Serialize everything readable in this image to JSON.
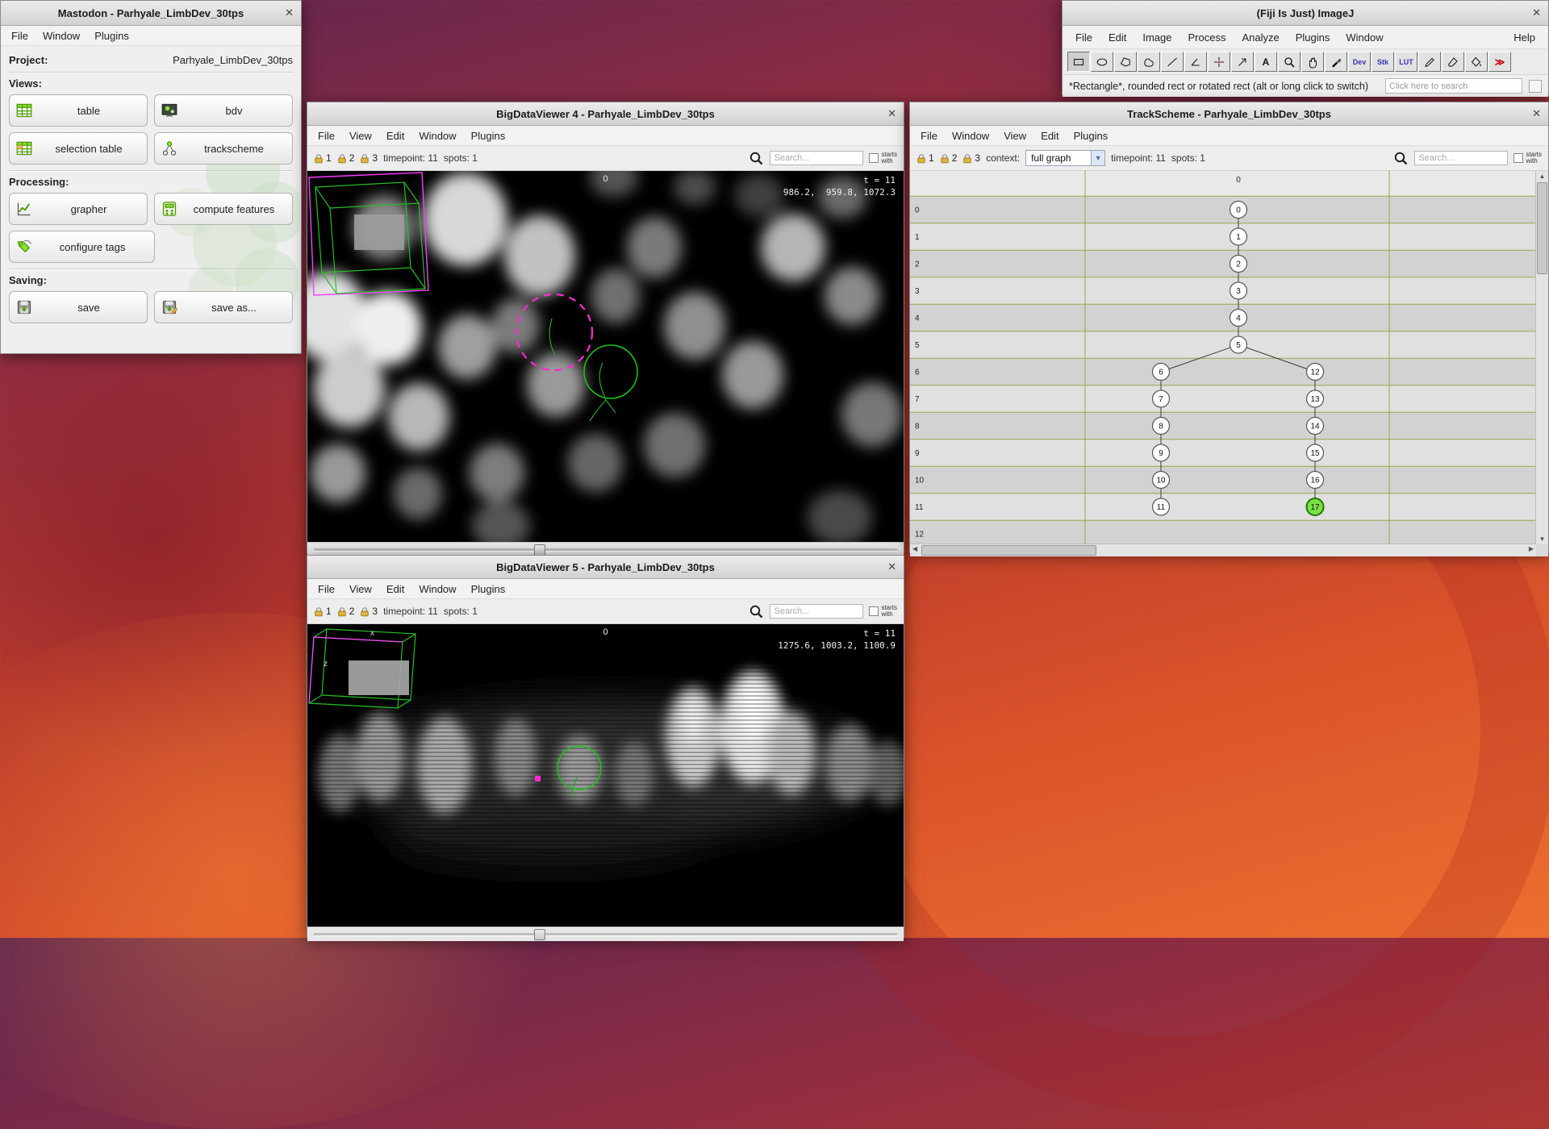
{
  "ui": {
    "close_glyph": "✕",
    "combo_arrow": "▾",
    "arrow_up": "▲",
    "arrow_down": "▼",
    "arrow_left": "◀",
    "arrow_right": "▶"
  },
  "mastodon": {
    "title": "Mastodon - Parhyale_LimbDev_30tps",
    "menus": [
      "File",
      "Window",
      "Plugins"
    ],
    "project_label": "Project:",
    "project_value": "Parhyale_LimbDev_30tps",
    "views_label": "Views:",
    "views": [
      {
        "label": "table",
        "icon": "table-icon"
      },
      {
        "label": "bdv",
        "icon": "bdv-icon"
      },
      {
        "label": "selection table",
        "icon": "selection-table-icon"
      },
      {
        "label": "trackscheme",
        "icon": "trackscheme-icon"
      }
    ],
    "processing_label": "Processing:",
    "processing": [
      {
        "label": "grapher",
        "icon": "grapher-icon"
      },
      {
        "label": "compute features",
        "icon": "compute-features-icon"
      },
      {
        "label": "configure tags",
        "icon": "configure-tags-icon"
      }
    ],
    "saving_label": "Saving:",
    "saving": [
      {
        "label": "save",
        "icon": "save-icon"
      },
      {
        "label": "save as...",
        "icon": "save-as-icon"
      }
    ]
  },
  "imagej": {
    "title": "(Fiji Is Just) ImageJ",
    "menus": [
      "File",
      "Edit",
      "Image",
      "Process",
      "Analyze",
      "Plugins",
      "Window",
      "Help"
    ],
    "tools": [
      {
        "name": "rectangle-tool"
      },
      {
        "name": "oval-tool"
      },
      {
        "name": "polygon-tool"
      },
      {
        "name": "freehand-tool"
      },
      {
        "name": "line-tool"
      },
      {
        "name": "angle-tool"
      },
      {
        "name": "point-tool"
      },
      {
        "name": "arrow-tool"
      },
      {
        "name": "text-tool",
        "label": "A"
      },
      {
        "name": "zoom-tool"
      },
      {
        "name": "hand-tool"
      },
      {
        "name": "color-picker-tool"
      },
      {
        "name": "dev-tool",
        "label": "Dev"
      },
      {
        "name": "stk-tool",
        "label": "Stk"
      },
      {
        "name": "lut-tool",
        "label": "LUT"
      },
      {
        "name": "pencil-tool"
      },
      {
        "name": "brush-tool"
      },
      {
        "name": "flood-fill-tool"
      },
      {
        "name": "more-tools",
        "label": "≫"
      }
    ],
    "status": "*Rectangle*, rounded rect or rotated rect (alt or long click to switch)",
    "search_placeholder": "Click here to search"
  },
  "bdv4": {
    "title": "BigDataViewer 4 - Parhyale_LimbDev_30tps",
    "menus": [
      "File",
      "View",
      "Edit",
      "Window",
      "Plugins"
    ],
    "locks": [
      "1",
      "2",
      "3"
    ],
    "timepoint": "timepoint: 11",
    "spots": "spots: 1",
    "search_placeholder": "Search...",
    "starts_with_1": "starts",
    "starts_with_2": "with",
    "overlay_source": "0",
    "overlay_time": "t = 11",
    "overlay_coords": "986.2,  959.8, 1072.3"
  },
  "bdv5": {
    "title": "BigDataViewer 5 - Parhyale_LimbDev_30tps",
    "menus": [
      "File",
      "View",
      "Edit",
      "Window",
      "Plugins"
    ],
    "locks": [
      "1",
      "2",
      "3"
    ],
    "timepoint": "timepoint: 11",
    "spots": "spots: 1",
    "search_placeholder": "Search...",
    "starts_with_1": "starts",
    "starts_with_2": "with",
    "overlay_source": "0",
    "overlay_time": "t = 11",
    "overlay_coords": "1275.6, 1003.2, 1100.9",
    "axis_x": "x",
    "axis_z": "z"
  },
  "trackscheme": {
    "title": "TrackScheme - Parhyale_LimbDev_30tps",
    "menus": [
      "File",
      "Window",
      "View",
      "Edit",
      "Plugins"
    ],
    "locks": [
      "1",
      "2",
      "3"
    ],
    "context_label": "context:",
    "context_value": "full graph",
    "timepoint": "timepoint: 11",
    "spots": "spots: 1",
    "search_placeholder": "Search...",
    "starts_with_1": "starts",
    "starts_with_2": "with",
    "column_header": "0",
    "row_labels": [
      "0",
      "1",
      "2",
      "3",
      "4",
      "5",
      "6",
      "7",
      "8",
      "9",
      "10",
      "11",
      "12"
    ],
    "graph": {
      "nodes": [
        {
          "id": "0",
          "t": 0,
          "branch": "c"
        },
        {
          "id": "1",
          "t": 1,
          "branch": "c"
        },
        {
          "id": "2",
          "t": 2,
          "branch": "c"
        },
        {
          "id": "3",
          "t": 3,
          "branch": "c"
        },
        {
          "id": "4",
          "t": 4,
          "branch": "c"
        },
        {
          "id": "5",
          "t": 5,
          "branch": "c"
        },
        {
          "id": "6",
          "t": 6,
          "branch": "l"
        },
        {
          "id": "7",
          "t": 7,
          "branch": "l"
        },
        {
          "id": "8",
          "t": 8,
          "branch": "l"
        },
        {
          "id": "9",
          "t": 9,
          "branch": "l"
        },
        {
          "id": "10",
          "t": 10,
          "branch": "l"
        },
        {
          "id": "11",
          "t": 11,
          "branch": "l"
        },
        {
          "id": "12",
          "t": 6,
          "branch": "r"
        },
        {
          "id": "13",
          "t": 7,
          "branch": "r"
        },
        {
          "id": "14",
          "t": 8,
          "branch": "r"
        },
        {
          "id": "15",
          "t": 9,
          "branch": "r"
        },
        {
          "id": "16",
          "t": 10,
          "branch": "r"
        },
        {
          "id": "17",
          "t": 11,
          "branch": "r",
          "selected": true
        }
      ],
      "edges": [
        [
          "0",
          "1"
        ],
        [
          "1",
          "2"
        ],
        [
          "2",
          "3"
        ],
        [
          "3",
          "4"
        ],
        [
          "4",
          "5"
        ],
        [
          "5",
          "6"
        ],
        [
          "5",
          "12"
        ],
        [
          "6",
          "7"
        ],
        [
          "7",
          "8"
        ],
        [
          "8",
          "9"
        ],
        [
          "9",
          "10"
        ],
        [
          "10",
          "11"
        ],
        [
          "12",
          "13"
        ],
        [
          "13",
          "14"
        ],
        [
          "14",
          "15"
        ],
        [
          "15",
          "16"
        ],
        [
          "16",
          "17"
        ]
      ],
      "selected_color": "#7be046"
    }
  }
}
